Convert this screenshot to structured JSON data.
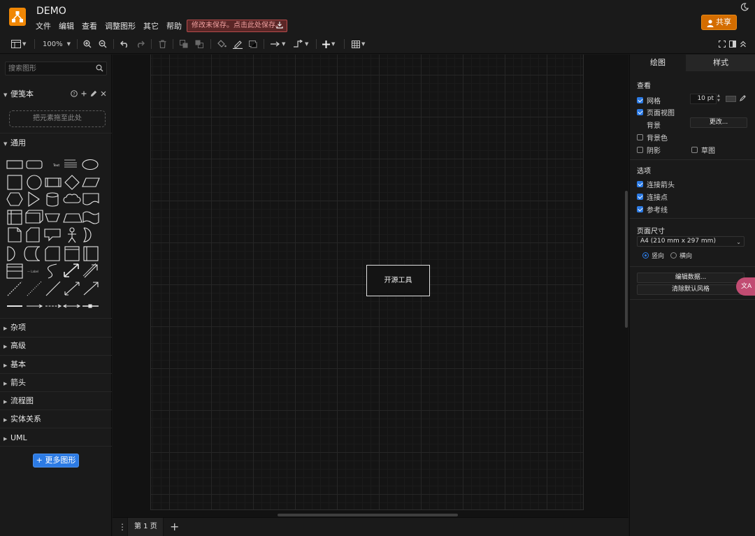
{
  "header": {
    "title": "DEMO",
    "menu": [
      "文件",
      "编辑",
      "查看",
      "调整图形",
      "其它",
      "帮助"
    ],
    "save_warning": "修改未保存。点击此处保存。",
    "share_label": "共享"
  },
  "toolbar": {
    "zoom": "100%"
  },
  "sidebar": {
    "search_placeholder": "搜索图形",
    "scratchpad_title": "便笺本",
    "scratchpad_drop": "把元素拖至此处",
    "general_title": "通用",
    "sections": [
      "杂项",
      "高级",
      "基本",
      "箭头",
      "流程图",
      "实体关系",
      "UML"
    ],
    "more_shapes": "更多图形"
  },
  "canvas": {
    "shape_text": "开源工具"
  },
  "pagebar": {
    "page_tab": "第 1 页"
  },
  "rpanel": {
    "tabs": [
      "绘图",
      "样式"
    ],
    "view_title": "查看",
    "grid_label": "网格",
    "grid_size": "10 pt",
    "page_view_label": "页面视图",
    "background_label": "背景",
    "change_button": "更改...",
    "background_color_label": "背景色",
    "shadow_label": "阴影",
    "sketch_label": "草图",
    "options_title": "选项",
    "connection_arrows_label": "连接箭头",
    "connection_points_label": "连接点",
    "guides_label": "参考线",
    "paper_size_title": "页面尺寸",
    "paper_size_value": "A4 (210 mm x 297 mm)",
    "portrait_label": "竖向",
    "landscape_label": "横向",
    "edit_data_button": "编辑数据...",
    "clear_style_button": "清除默认风格"
  },
  "colors": {
    "accent": "#2c7be5",
    "brand": "#f08705",
    "share": "#d46d00",
    "warning_bg": "#5a2626"
  }
}
